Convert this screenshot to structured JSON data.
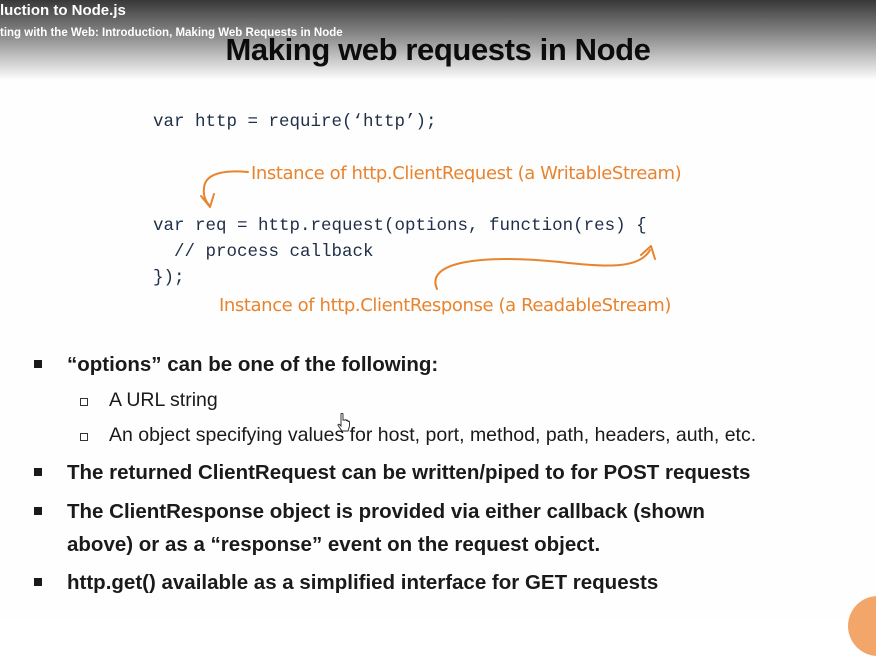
{
  "player": {
    "course_title": "luction to Node.js",
    "module_title": "ting with the Web: Introduction, Making Web Requests in Node"
  },
  "slide": {
    "title": "Making web requests in Node",
    "code": {
      "line1": "var http = require(‘http’);",
      "line2": "var req = http.request(options, function(res) {",
      "line3": "  // process callback",
      "line4": "});"
    },
    "annotations": {
      "request": "Instance of http.ClientRequest (a WritableStream)",
      "response": "Instance of http.ClientResponse (a ReadableStream)"
    },
    "bullets": [
      {
        "text": "“options”  can be one of the following:"
      },
      {
        "text": "The returned ClientRequest  can be written/piped  to for POST requests"
      },
      {
        "text": "The ClientResponse  object is provided  via either callback (shown"
      },
      {
        "text": "above) or as a “response” event on the request object."
      },
      {
        "text": "http.get() available  as a simplified  interface for GET requests"
      }
    ],
    "sub_bullets": [
      {
        "text": "A URL string"
      },
      {
        "text": "An object specifying values for host, port, method, path, headers, auth, etc."
      }
    ]
  },
  "colors": {
    "annotation": "#e8832e",
    "code": "#1f2f47",
    "text": "#1a1a1a"
  },
  "icons": {
    "cursor": "mouse-pointer-icon"
  }
}
